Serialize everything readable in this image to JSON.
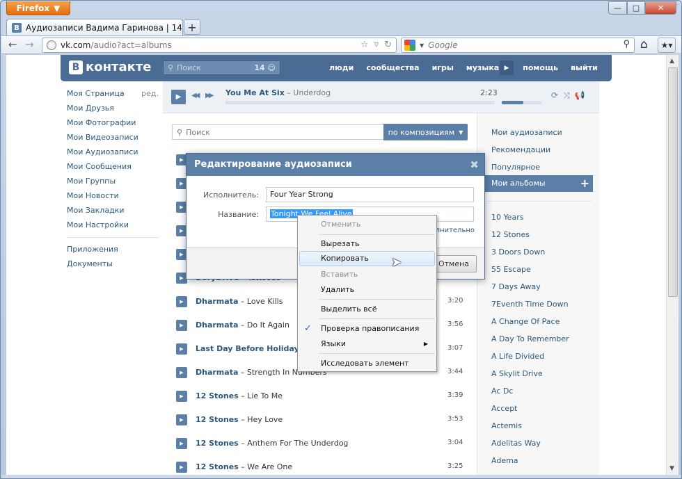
{
  "browser": {
    "app_button": "Firefox",
    "tab_favicon": "B",
    "tab_title": "Аудиозаписи Вадима Гаринова | 1424 а...",
    "url_host": "vk.com",
    "url_path": "/audio?act=albums",
    "search_engine": "Google"
  },
  "vk": {
    "logo": "контакте",
    "logo_mark": "В",
    "search_placeholder": "Поиск",
    "search_count": "14",
    "nav": [
      "люди",
      "сообщества",
      "игры",
      "музыка",
      "помощь",
      "выйти"
    ]
  },
  "left_menu": {
    "edit_label": "ред.",
    "items": [
      "Моя Страница",
      "Мои Друзья",
      "Мои Фотографии",
      "Мои Видеозаписи",
      "Мои Аудиозаписи",
      "Мои Сообщения",
      "Мои Группы",
      "Мои Новости",
      "Мои Закладки",
      "Мои Настройки"
    ],
    "extra": [
      "Приложения",
      "Документы"
    ]
  },
  "player": {
    "artist": "You Me At Six",
    "title": " – Underdog",
    "time": "2:23",
    "volume_fraction": 0.55
  },
  "audio_search": {
    "placeholder": "Поиск",
    "mode": "по композициям"
  },
  "tracks": [
    {
      "artist": "DoryDrive",
      "title": " – Tattooed",
      "duration": "3:31"
    },
    {
      "artist": "Dharmata",
      "title": " – Love Kills",
      "duration": "3:20"
    },
    {
      "artist": "Dharmata",
      "title": " – Do It Again",
      "duration": "3:56"
    },
    {
      "artist": "Last Day Before Holiday",
      "title": " –",
      "duration": "3:07"
    },
    {
      "artist": "Dharmata",
      "title": " – Strength In Numbers",
      "duration": "3:44"
    },
    {
      "artist": "12 Stones",
      "title": " – Lie To Me",
      "duration": "3:39"
    },
    {
      "artist": "12 Stones",
      "title": " – Hey Love",
      "duration": "3:53"
    },
    {
      "artist": "12 Stones",
      "title": " – Anthem For The Underdog",
      "duration": "3:04"
    },
    {
      "artist": "12 Stones",
      "title": " – We Are One",
      "duration": "3:25"
    }
  ],
  "right_col": {
    "sections": [
      "Мои аудиозаписи",
      "Рекомендации",
      "Популярное"
    ],
    "active": "Мои альбомы",
    "albums": [
      "10 Years",
      "12 Stones",
      "3 Doors Down",
      "55 Escape",
      "7 Days Away",
      "7Eventh Time Down",
      "A Change Of Pace",
      "A Day To Remember",
      "A Life Divided",
      "A Skylit Drive",
      "Ac Dc",
      "Accept",
      "Actemis",
      "Adelitas Way",
      "Adema"
    ]
  },
  "dialog": {
    "title": "Редактирование аудиозаписи",
    "artist_label": "Исполнитель:",
    "artist_value": "Four Year Strong",
    "name_label": "Название:",
    "name_value": "Tonight We Feel Alive",
    "more_link": "олнительно",
    "cancel": "Отмена"
  },
  "context_menu": {
    "undo": "Отменить",
    "cut": "Вырезать",
    "copy": "Копировать",
    "paste": "Вставить",
    "delete": "Удалить",
    "select_all": "Выделить всё",
    "spellcheck": "Проверка правописания",
    "languages": "Языки",
    "inspect": "Исследовать элемент"
  }
}
